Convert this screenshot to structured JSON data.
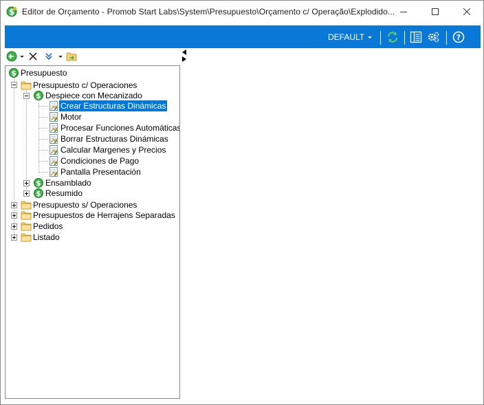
{
  "window": {
    "title": "Editor de Orçamento - Promob Start Labs\\System\\Presupuesto\\Orçamento c/ Operação\\Explodido...",
    "minimize_icon": "minimize-icon",
    "maximize_icon": "maximize-icon",
    "close_icon": "close-icon"
  },
  "toolbar": {
    "profile": "DEFAULT",
    "accent": "#0a78d7",
    "buttons": [
      "refresh-icon",
      "layout-panel-icon",
      "settings-gears-icon",
      "help-icon"
    ]
  },
  "tree_toolbar": {
    "buttons": [
      "back-arrow-icon",
      "delete-x-icon",
      "move-down-icon",
      "folder-export-icon"
    ]
  },
  "tree": {
    "root": "Presupuesto",
    "group1": "Presupuesto c/ Operaciones",
    "sub1": "Despiece con Mecanizado",
    "items": [
      "Crear Estructuras Dinámicas",
      "Motor",
      "Procesar Funciones Automáticas",
      "Borrar Estructuras Dinámicas",
      "Calcular Margenes y Precios",
      "Condiciones de Pago",
      "Pantalla Presentación"
    ],
    "sub2": "Ensamblado",
    "sub3": "Resumido",
    "group2": "Presupuesto s/ Operaciones",
    "group3": "Presupuestos de Herrajens Separadas",
    "group4": "Pedidos",
    "group5": "Listado",
    "selected_item": "Crear Estructuras Dinámicas"
  }
}
